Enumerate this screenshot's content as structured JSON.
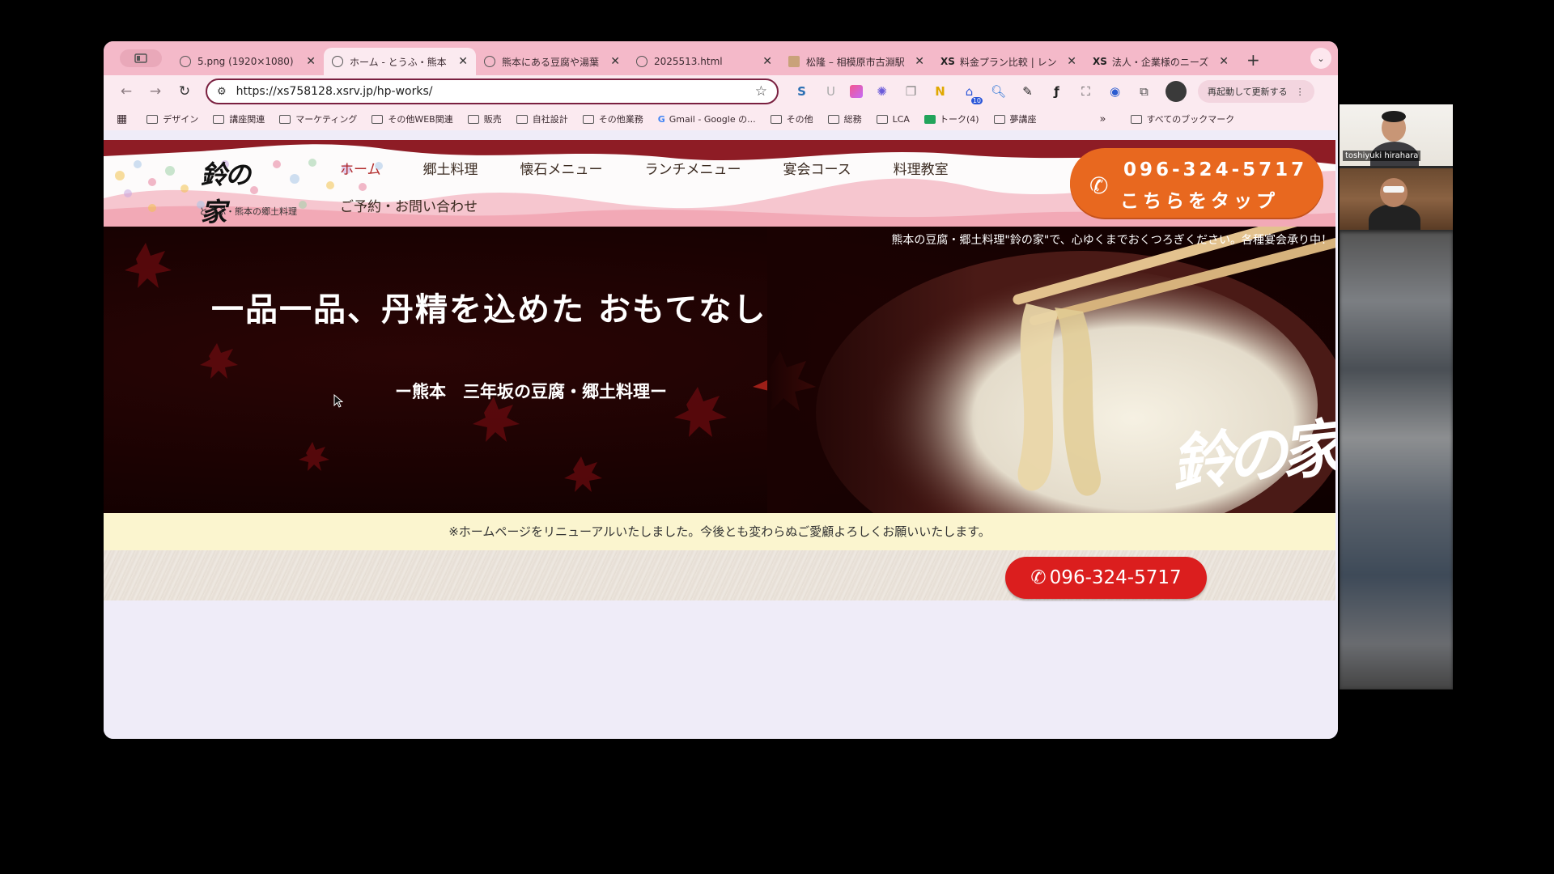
{
  "browser": {
    "tabs": [
      {
        "title": "5.png (1920×1080)",
        "active": false,
        "favicon": "globe-icon"
      },
      {
        "title": "ホーム - とうふ・熊本",
        "active": true,
        "favicon": "globe-icon"
      },
      {
        "title": "熊本にある豆腐や湯葉",
        "active": false,
        "favicon": "globe-icon"
      },
      {
        "title": "2025513.html",
        "active": false,
        "favicon": "globe-icon"
      },
      {
        "title": "松隆 – 相模原市古淵駅",
        "active": false,
        "favicon": "image-icon"
      },
      {
        "title": "料金プラン比較 | レン",
        "active": false,
        "favicon": "xs-icon"
      },
      {
        "title": "法人・企業様のニーズ",
        "active": false,
        "favicon": "xs-icon"
      }
    ],
    "url": "https://xs758128.xsrv.jp/hp-works/",
    "update_button": "再起動して更新する",
    "extension_badge": "10",
    "bookmarks": [
      {
        "label": "デザイン",
        "type": "folder"
      },
      {
        "label": "講座関連",
        "type": "folder"
      },
      {
        "label": "マーケティング",
        "type": "folder"
      },
      {
        "label": "その他WEB関連",
        "type": "folder"
      },
      {
        "label": "販売",
        "type": "folder"
      },
      {
        "label": "自社設計",
        "type": "folder"
      },
      {
        "label": "その他業務",
        "type": "folder"
      },
      {
        "label": "Gmail - Google の...",
        "type": "gmail"
      },
      {
        "label": "その他",
        "type": "folder"
      },
      {
        "label": "総務",
        "type": "folder"
      },
      {
        "label": "LCA",
        "type": "folder"
      },
      {
        "label": "トーク(4)",
        "type": "chat"
      },
      {
        "label": "夢講座",
        "type": "folder"
      }
    ],
    "all_bookmarks": "すべてのブックマーク"
  },
  "site": {
    "logo_text": "鈴の家",
    "logo_sub": "とうふ・熊本の郷土料理",
    "nav": [
      "ホーム",
      "郷土料理",
      "懐石メニュー",
      "ランチメニュー",
      "宴会コース",
      "料理教室"
    ],
    "nav_second_row": "ご予約・お問い合わせ",
    "cta_phone": "096-324-5717",
    "cta_tap": "こちらをタップ",
    "ticker": "熊本の豆腐・郷土料理\"鈴の家\"で、心ゆくまでおくつろぎください。各種宴会承り中！",
    "hero_title": "一品一品、丹精を込めた おもてなし",
    "hero_subtitle": "ー熊本　三年坂の豆腐・郷土料理ー",
    "hero_logo": "鈴の家",
    "notice": "※ホームページをリニューアルいたしました。今後とも変わらぬご愛顧よろしくお願いいたします。",
    "tel_button": "096-324-5717"
  },
  "meeting": {
    "participant_name": "toshiyuki hirahara"
  },
  "colors": {
    "tab_strip": "#f4b9c9",
    "toolbar": "#fbeaf0",
    "cta_orange": "#e8681f",
    "tel_red": "#db1e1e",
    "notice_bg": "#fbf5cf",
    "hero_dark": "#1a0202"
  }
}
